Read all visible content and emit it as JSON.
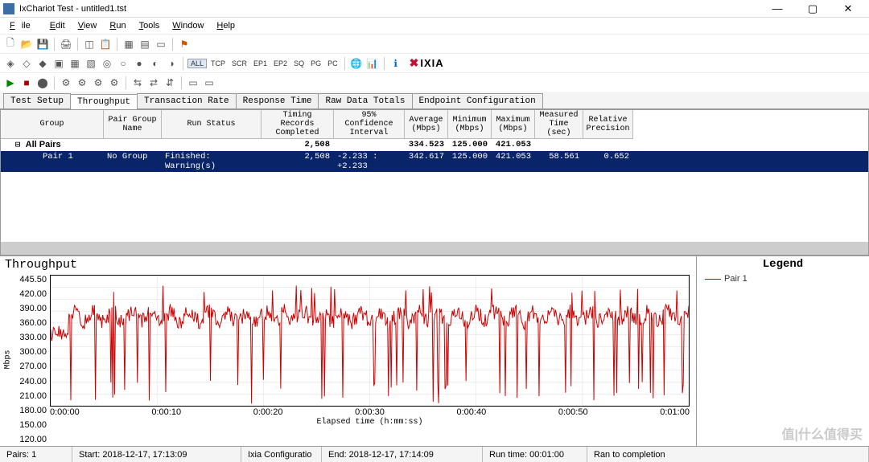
{
  "window": {
    "title": "IxChariot Test - untitled1.tst"
  },
  "menu": [
    "File",
    "Edit",
    "View",
    "Run",
    "Tools",
    "Window",
    "Help"
  ],
  "filter_buttons": [
    "ALL",
    "TCP",
    "SCR",
    "EP1",
    "EP2",
    "SQ",
    "PG",
    "PC"
  ],
  "brand": "IXIA",
  "tabs": [
    "Test Setup",
    "Throughput",
    "Transaction Rate",
    "Response Time",
    "Raw Data Totals",
    "Endpoint Configuration"
  ],
  "active_tab": 1,
  "grid": {
    "headers": [
      "Group",
      "Pair Group Name",
      "Run Status",
      "Timing Records Completed",
      "95% Confidence Interval",
      "Average (Mbps)",
      "Minimum (Mbps)",
      "Maximum (Mbps)",
      "Measured Time (sec)",
      "Relative Precision"
    ],
    "parent": {
      "label": "All Pairs",
      "timing": "2,508",
      "avg": "334.523",
      "min": "125.000",
      "max": "421.053"
    },
    "row": {
      "label": "Pair 1",
      "pgn": "No Group",
      "run": "Finished: Warning(s)",
      "timing": "2,508",
      "ci": "-2.233 : +2.233",
      "avg": "342.617",
      "min": "125.000",
      "max": "421.053",
      "mt": "58.561",
      "rp": "0.652"
    }
  },
  "chart_data": {
    "type": "line",
    "title": "Throughput",
    "ylabel": "Mbps",
    "xlabel": "Elapsed time (h:mm:ss)",
    "ylim": [
      120,
      445.5
    ],
    "yticks": [
      "445.50",
      "420.00",
      "390.00",
      "360.00",
      "330.00",
      "300.00",
      "270.00",
      "240.00",
      "210.00",
      "180.00",
      "150.00",
      "120.00"
    ],
    "xticks": [
      "0:00:00",
      "0:00:10",
      "0:00:20",
      "0:00:30",
      "0:00:40",
      "0:00:50",
      "0:01:00"
    ],
    "series": [
      {
        "name": "Pair 1",
        "color": "#cc0000",
        "mean": 342.617,
        "min": 125.0,
        "max": 421.053,
        "samples": 2508
      }
    ]
  },
  "legend_title": "Legend",
  "status": {
    "pairs": "Pairs: 1",
    "start": "Start: 2018-12-17, 17:13:09",
    "config": "Ixia Configuratio",
    "end": "End: 2018-12-17, 17:14:09",
    "runtime": "Run time: 00:01:00",
    "ran": "Ran to completion"
  },
  "watermark": "值|什么值得买"
}
